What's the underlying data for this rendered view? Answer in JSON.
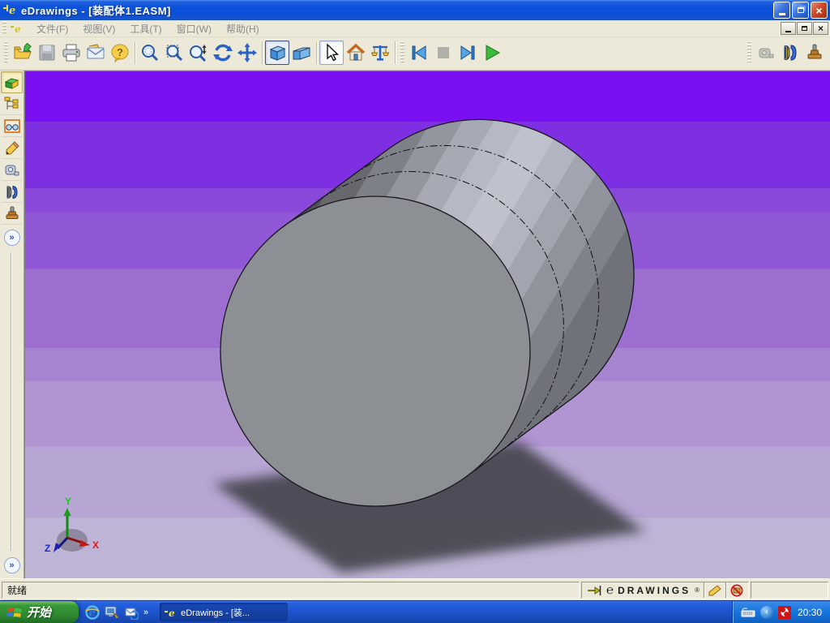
{
  "window": {
    "title": "eDrawings - [装配体1.EASM]"
  },
  "menubar": {
    "items": [
      {
        "label": "文件(F)"
      },
      {
        "label": "视图(V)"
      },
      {
        "label": "工具(T)"
      },
      {
        "label": "窗口(W)"
      },
      {
        "label": "帮助(H)"
      }
    ]
  },
  "statusbar": {
    "ready_text": "就绪",
    "brand_e": "℮",
    "brand_name": "DRAWINGS",
    "brand_reg": "®"
  },
  "taskbar": {
    "start_label": "开始",
    "quicklaunch_more": "»",
    "task_label": "eDrawings - [装...",
    "clock": "20:30"
  },
  "sidebar": {
    "expand_top": "»",
    "expand_bottom": "»"
  },
  "viewport": {
    "axis": {
      "x": "X",
      "y": "Y",
      "z": "Z"
    }
  },
  "colors": {
    "titlebar_blue": "#0A50D8",
    "toolbar_tan": "#ECE9D8",
    "viewport_gradient_top": "#7A0FF2",
    "viewport_gradient_bottom": "#BFB6D6",
    "model_front_face": "#8C9095",
    "model_side_light": "#BFC2CD",
    "model_side_dark": "#4F5156",
    "shadow": "#3F3F46",
    "axis_x_red": "#D01818",
    "axis_y_green": "#18A818",
    "axis_z_blue": "#1828C8",
    "close_button_red": "#D0492A",
    "taskbar_blue": "#1E53CC",
    "start_green": "#2E8530"
  }
}
